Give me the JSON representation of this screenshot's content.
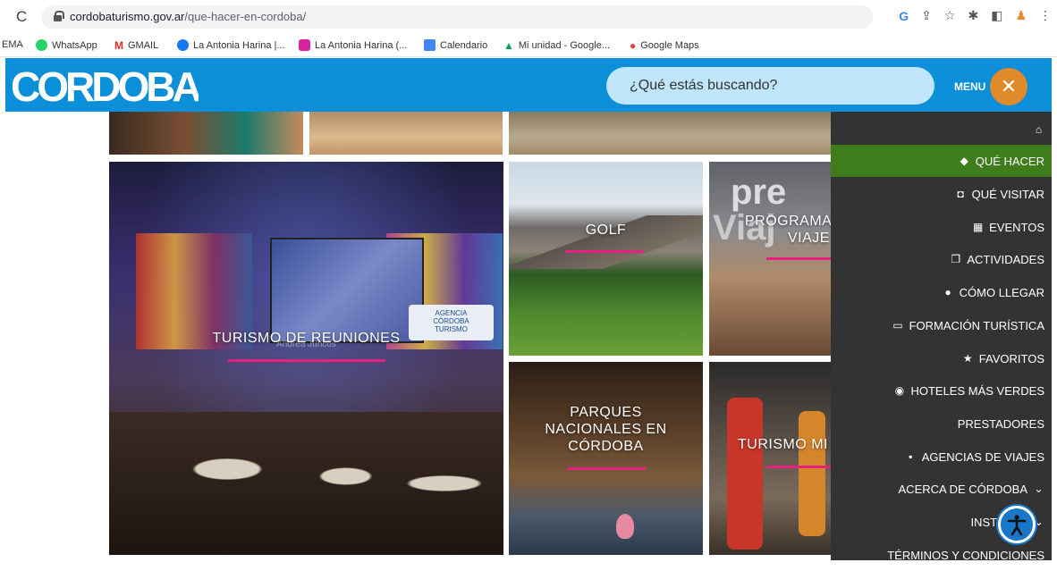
{
  "browser": {
    "url_domain": "cordobaturismo.gov.ar",
    "url_path": "/que-hacer-en-cordoba/",
    "bookmarks": [
      {
        "label": "EMA",
        "icon": "truncated-bookmark"
      },
      {
        "label": "WhatsApp",
        "icon": "whatsapp-icon"
      },
      {
        "label": "GMAIL",
        "icon": "gmail-icon"
      },
      {
        "label": "La Antonia Harina |...",
        "icon": "facebook-icon"
      },
      {
        "label": "La Antonia Harina (...",
        "icon": "instagram-icon"
      },
      {
        "label": "Calendario",
        "icon": "calendar-icon"
      },
      {
        "label": "Mi unidad - Google...",
        "icon": "google-drive-icon"
      },
      {
        "label": "Google Maps",
        "icon": "google-maps-icon"
      }
    ]
  },
  "header": {
    "logo_text": "CORDOBA",
    "search_placeholder": "¿Qué estás buscando?",
    "menu_label": "MENU",
    "close_symbol": "✕"
  },
  "tiles": {
    "reuniones": "TURISMO DE REUNIONES",
    "reuniones_sub": "Andrea Juncos",
    "golf": "GOLF",
    "programa_line1": "PROGRAMA",
    "programa_line2": "VIAJE",
    "parques_line1": "PARQUES",
    "parques_line2": "NACIONALES EN",
    "parques_line3": "CÓRDOBA",
    "turismo": "TURISMO MI",
    "screen_text_1": "AGENCIA",
    "screen_text_2": "CÓRDOBA",
    "screen_text_3": "TURISMO",
    "prog_bg_text_1": "pre",
    "prog_bg_text_2": "Viaj"
  },
  "side_menu": [
    {
      "label": "",
      "icon": "home-icon",
      "glyph": "⌂"
    },
    {
      "label": "QUÉ HACER",
      "icon": "tag-icon",
      "glyph": "◆",
      "active": true
    },
    {
      "label": "QUÉ VISITAR",
      "icon": "camera-icon",
      "glyph": "◘"
    },
    {
      "label": "EVENTOS",
      "icon": "calendar-icon",
      "glyph": "▦"
    },
    {
      "label": "ACTIVIDADES",
      "icon": "activities-icon",
      "glyph": "❐"
    },
    {
      "label": "CÓMO LLEGAR",
      "icon": "map-pin-icon",
      "glyph": "●"
    },
    {
      "label": "FORMACIÓN TURÍSTICA",
      "icon": "presentation-icon",
      "glyph": "▭"
    },
    {
      "label": "FAVORITOS",
      "icon": "star-icon",
      "glyph": "★"
    },
    {
      "label": "HOTELES MÁS VERDES",
      "icon": "globe-icon",
      "glyph": "◉"
    },
    {
      "label": "PRESTADORES",
      "icon": "",
      "glyph": ""
    },
    {
      "label": "AGENCIAS DE VIAJES",
      "icon": "grid-icon",
      "glyph": "▪"
    },
    {
      "label": "ACERCA DE CÓRDOBA",
      "icon": "chevron-down-icon",
      "glyph": "⌄",
      "trailing": true
    },
    {
      "label": "INSTITUCI",
      "icon": "chevron-down-icon",
      "glyph": "⌄",
      "trailing": true
    },
    {
      "label": "TÉRMINOS Y CONDICIONES",
      "icon": "",
      "glyph": ""
    }
  ],
  "colors": {
    "header_blue": "#0b8fd9",
    "search_bg": "#bfe6fb",
    "close_orange": "#e08a2c",
    "menu_bg": "#333333",
    "menu_active": "#3f7c1c",
    "accent_pink": "#e6207c"
  }
}
